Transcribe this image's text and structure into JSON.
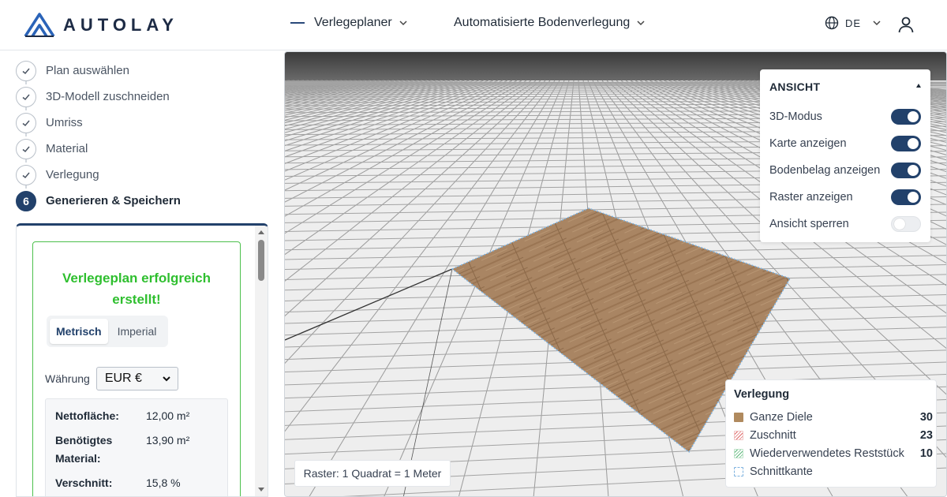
{
  "header": {
    "logo_text": "AUTOLAY",
    "nav": [
      {
        "label": "Verlegeplaner"
      },
      {
        "label": "Automatisierte Bodenverlegung"
      }
    ],
    "language": "DE"
  },
  "steps": [
    {
      "label": "Plan auswählen",
      "done": true
    },
    {
      "label": "3D-Modell zuschneiden",
      "done": true
    },
    {
      "label": "Umriss",
      "done": true
    },
    {
      "label": "Material",
      "done": true
    },
    {
      "label": "Verlegung",
      "done": true
    },
    {
      "label": "Generieren & Speichern",
      "number": "6",
      "active": true
    }
  ],
  "panel": {
    "success_line1": "Verlegeplan erfolgreich",
    "success_line2": "erstellt!",
    "units": [
      "Metrisch",
      "Imperial"
    ],
    "currency_label": "Währung",
    "currency_value": "EUR €",
    "stats": [
      {
        "key": "Nettofläche:",
        "value": "12,00 m²"
      },
      {
        "key_line1": "Benötigtes",
        "key_line2": "Material:",
        "value": "13,90 m²"
      },
      {
        "key": "Verschnitt:",
        "value": "15,8 %"
      }
    ]
  },
  "view_panel": {
    "title": "ANSICHT",
    "toggles": [
      {
        "label": "3D-Modus",
        "on": true
      },
      {
        "label": "Karte anzeigen",
        "on": true
      },
      {
        "label": "Bodenbelag anzeigen",
        "on": true
      },
      {
        "label": "Raster anzeigen",
        "on": true
      },
      {
        "label": "Ansicht sperren",
        "on": false
      }
    ]
  },
  "legend": {
    "title": "Verlegung",
    "items": [
      {
        "name": "Ganze Diele",
        "count": "30",
        "color": "#b08a5e"
      },
      {
        "name": "Zuschnitt",
        "count": "23",
        "color": "#e06a6a"
      },
      {
        "name": "Wiederverwendetes Reststück",
        "count": "10",
        "color": "#5cb87a"
      },
      {
        "name": "Schnittkante",
        "count": "",
        "color": "#7fb3e0"
      }
    ]
  },
  "raster_label": "Raster: 1 Quadrat = 1 Meter",
  "colors": {
    "accent": "#22416b",
    "success": "#2fbf2f",
    "floor_wood": "#a98563"
  }
}
